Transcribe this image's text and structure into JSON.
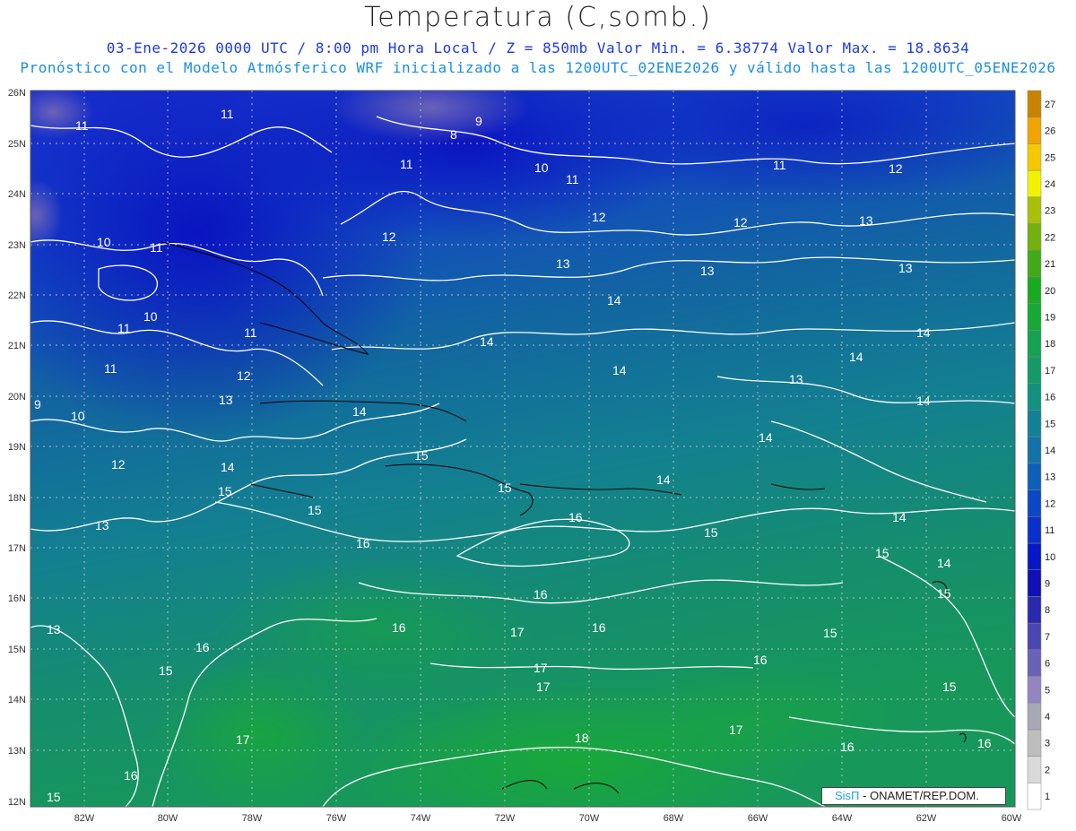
{
  "header": {
    "title": "Temperatura (C,somb.)",
    "line1": "03-Ene-2026  0000 UTC / 8:00 pm Hora Local / Z = 850mb    Valor Min. = 6.38774  Valor Max. = 18.8634",
    "line2": "Pronóstico con el Modelo Atmósferico WRF inicializado a las 1200UTC_02ENE2026 y válido hasta las  1200UTC_05ENE2026"
  },
  "map": {
    "lat_ticks": [
      "26N",
      "25N",
      "24N",
      "23N",
      "22N",
      "21N",
      "20N",
      "19N",
      "18N",
      "17N",
      "16N",
      "15N",
      "14N",
      "13N",
      "12N"
    ],
    "lon_ticks": [
      "82W",
      "80W",
      "78W",
      "76W",
      "74W",
      "72W",
      "70W",
      "68W",
      "66W",
      "64W",
      "62W",
      "60W"
    ],
    "contour_labels": [
      {
        "text": "11"
      },
      {
        "text": "11"
      },
      {
        "text": "10"
      },
      {
        "text": "11"
      },
      {
        "text": "11"
      },
      {
        "text": "10"
      },
      {
        "text": "11"
      },
      {
        "text": "11"
      },
      {
        "text": "12"
      },
      {
        "text": "13"
      },
      {
        "text": "10"
      },
      {
        "text": "9"
      },
      {
        "text": "12"
      },
      {
        "text": "13"
      },
      {
        "text": "9"
      },
      {
        "text": "8"
      },
      {
        "text": "11"
      },
      {
        "text": "12"
      },
      {
        "text": "10"
      },
      {
        "text": "11"
      },
      {
        "text": "12"
      },
      {
        "text": "12"
      },
      {
        "text": "11"
      },
      {
        "text": "12"
      },
      {
        "text": "13"
      },
      {
        "text": "13"
      },
      {
        "text": "13"
      },
      {
        "text": "13"
      },
      {
        "text": "14"
      },
      {
        "text": "14"
      },
      {
        "text": "14"
      },
      {
        "text": "14"
      },
      {
        "text": "14"
      },
      {
        "text": "14"
      },
      {
        "text": "13"
      },
      {
        "text": "14"
      },
      {
        "text": "14"
      },
      {
        "text": "14"
      },
      {
        "text": "14"
      },
      {
        "text": "15"
      },
      {
        "text": "15"
      },
      {
        "text": "15"
      },
      {
        "text": "14"
      },
      {
        "text": "15"
      },
      {
        "text": "16"
      },
      {
        "text": "16"
      },
      {
        "text": "15"
      },
      {
        "text": "15"
      },
      {
        "text": "14"
      },
      {
        "text": "15"
      },
      {
        "text": "16"
      },
      {
        "text": "16"
      },
      {
        "text": "17"
      },
      {
        "text": "16"
      },
      {
        "text": "17"
      },
      {
        "text": "17"
      },
      {
        "text": "15"
      },
      {
        "text": "16"
      },
      {
        "text": "15"
      },
      {
        "text": "15"
      },
      {
        "text": "18"
      },
      {
        "text": "17"
      },
      {
        "text": "17"
      },
      {
        "text": "16"
      },
      {
        "text": "16"
      },
      {
        "text": "13"
      },
      {
        "text": "15"
      },
      {
        "text": "16"
      },
      {
        "text": "13"
      },
      {
        "text": "16"
      }
    ],
    "colorbar": [
      {
        "label": "1",
        "color": "#ffffff"
      },
      {
        "label": "2",
        "color": "#d9d9d9"
      },
      {
        "label": "3",
        "color": "#bdbdbd"
      },
      {
        "label": "4",
        "color": "#a8a8b4"
      },
      {
        "label": "5",
        "color": "#9484c0"
      },
      {
        "label": "6",
        "color": "#6a62b8"
      },
      {
        "label": "7",
        "color": "#4a46b2"
      },
      {
        "label": "8",
        "color": "#2a2aac"
      },
      {
        "label": "9",
        "color": "#1010b4"
      },
      {
        "label": "10",
        "color": "#0818c6"
      },
      {
        "label": "11",
        "color": "#0a30cc"
      },
      {
        "label": "12",
        "color": "#0c48c4"
      },
      {
        "label": "13",
        "color": "#0e5fb8"
      },
      {
        "label": "14",
        "color": "#1173a8"
      },
      {
        "label": "15",
        "color": "#118296"
      },
      {
        "label": "16",
        "color": "#129080"
      },
      {
        "label": "17",
        "color": "#149a68"
      },
      {
        "label": "18",
        "color": "#16a250"
      },
      {
        "label": "19",
        "color": "#18a838"
      },
      {
        "label": "20",
        "color": "#1aaa22"
      },
      {
        "label": "21",
        "color": "#42aa18"
      },
      {
        "label": "22",
        "color": "#74b010"
      },
      {
        "label": "23",
        "color": "#a8c00a"
      },
      {
        "label": "24",
        "color": "#f2f200"
      },
      {
        "label": "25",
        "color": "#f6c800"
      },
      {
        "label": "26",
        "color": "#f0a400"
      },
      {
        "label": "27",
        "color": "#c88400"
      }
    ]
  },
  "credit": {
    "logo": "SisΠ",
    "text": " - ONAMET/REP.DOM."
  }
}
